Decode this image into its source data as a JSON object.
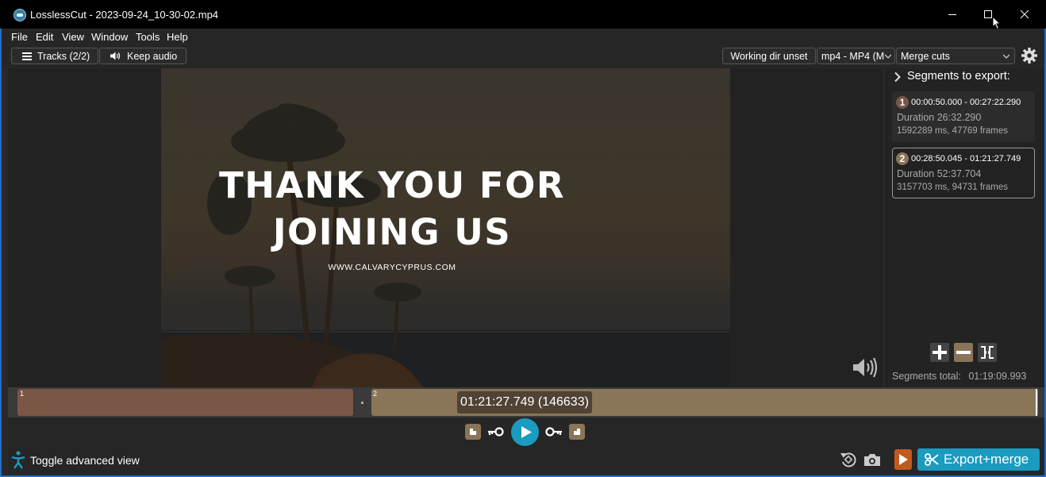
{
  "window": {
    "title": "LosslessCut - 2023-09-24_10-30-02.mp4",
    "minimize_icon": "minimize-icon",
    "maximize_icon": "maximize-icon",
    "close_icon": "close-icon"
  },
  "menu": [
    "File",
    "Edit",
    "View",
    "Window",
    "Tools",
    "Help"
  ],
  "toolbar": {
    "tracks_label": "Tracks (2/2)",
    "keep_audio_label": "Keep audio",
    "working_dir_label": "Working dir unset",
    "format_value": "mp4 - MP4 (M",
    "merge_value": "Merge cuts"
  },
  "video": {
    "line1": "THANK YOU FOR",
    "line2": "JOINING US",
    "website": "WWW.CALVARYCYPRUS.COM"
  },
  "sidebar": {
    "header": "Segments to export:",
    "segments": [
      {
        "num": "1",
        "range": "00:00:50.000 - 00:27:22.290",
        "duration": "Duration 26:32.290",
        "ms": "1592289 ms, 47769 frames",
        "color": "#7a5647"
      },
      {
        "num": "2",
        "range": "00:28:50.045 - 01:21:27.749",
        "duration": "Duration 52:37.704",
        "ms": "3157703 ms, 94731 frames",
        "color": "#8a7558"
      }
    ],
    "total_label": "Segments total:",
    "total_value": "01:19:09.993"
  },
  "timeline": {
    "seg1_label": "1",
    "seg2_label": "2",
    "current_time": "01:21:27.749 (146633)",
    "seg1_color": "#7a5647",
    "seg2_color": "#8a7558"
  },
  "bottom": {
    "toggle_label": "Toggle advanced view",
    "export_label": "Export+merge",
    "accent": "#1a9bbf"
  }
}
